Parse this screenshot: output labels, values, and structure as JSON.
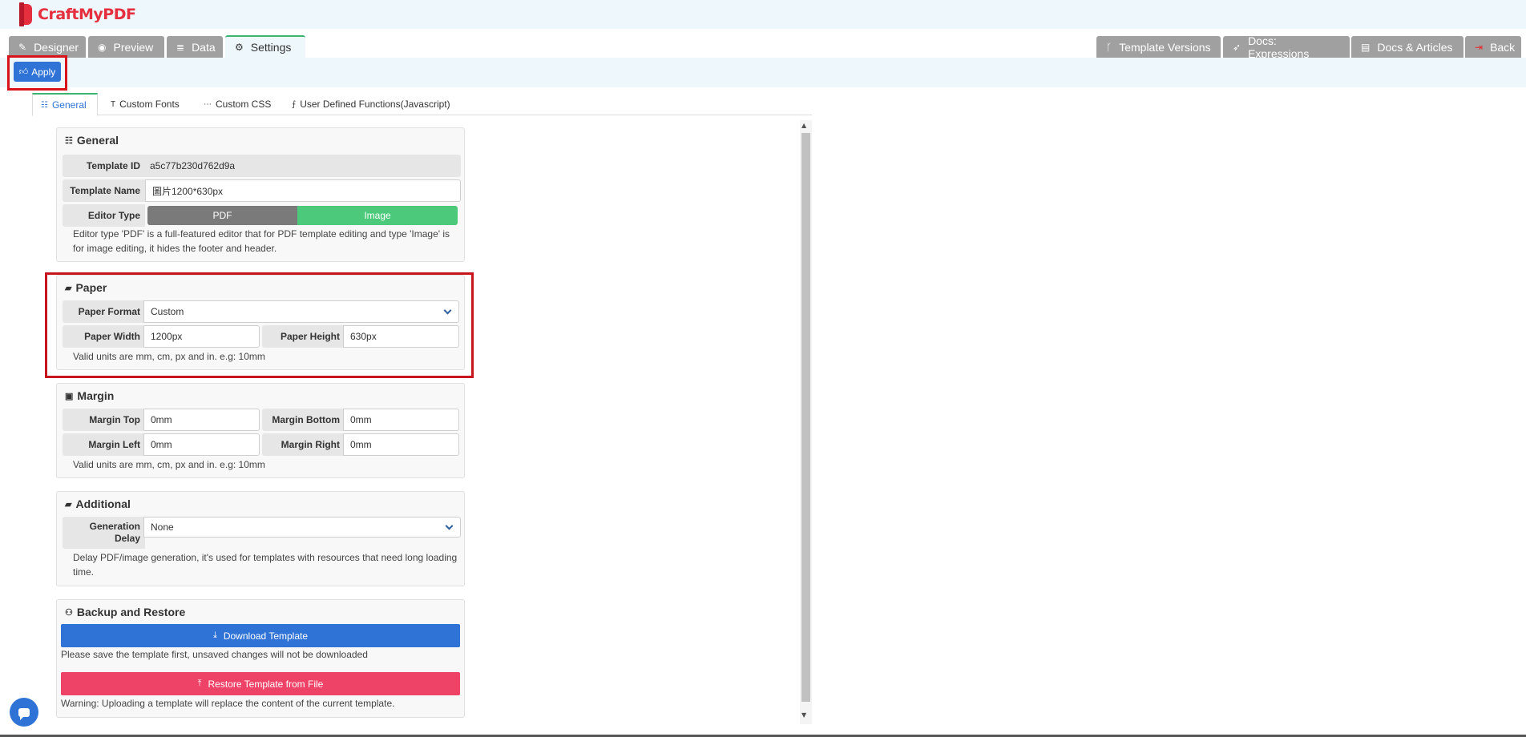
{
  "brand": {
    "logo_text": "CraftMyPDF",
    "accent": "#e52e3e"
  },
  "main_tabs": [
    {
      "label": "Designer",
      "icon": "pencil-icon"
    },
    {
      "label": "Preview",
      "icon": "eye-icon"
    },
    {
      "label": "Data",
      "icon": "database-icon"
    },
    {
      "label": "Settings",
      "icon": "gears-icon",
      "active": true
    }
  ],
  "right_tabs": [
    {
      "label": "Template Versions",
      "icon": "branch-icon"
    },
    {
      "label": "Docs: Expressions",
      "icon": "rocket-icon"
    },
    {
      "label": "Docs & Articles",
      "icon": "book-icon"
    },
    {
      "label": "Back",
      "icon": "exit-icon"
    }
  ],
  "apply": {
    "label": "Apply",
    "icon": "thumbs-up-icon"
  },
  "sub_tabs": [
    {
      "label": "General",
      "icon": "sliders-icon",
      "active": true
    },
    {
      "label": "Custom Fonts",
      "icon": "text-icon"
    },
    {
      "label": "Custom CSS",
      "icon": "code-icon"
    },
    {
      "label": "User Defined Functions(Javascript)",
      "icon": "function-icon"
    }
  ],
  "general": {
    "title": "General",
    "template_id_label": "Template ID",
    "template_id_value": "a5c77b230d762d9a",
    "template_name_label": "Template Name",
    "template_name_value": "圖片1200*630px",
    "editor_type_label": "Editor Type",
    "editor_pdf": "PDF",
    "editor_image": "Image",
    "help": "Editor type 'PDF' is a full-featured editor that for PDF template editing and type 'Image' is for image editing, it hides the footer and header."
  },
  "paper": {
    "title": "Paper",
    "format_label": "Paper Format",
    "format_value": "Custom",
    "width_label": "Paper Width",
    "width_value": "1200px",
    "height_label": "Paper Height",
    "height_value": "630px",
    "help": "Valid units are mm, cm, px and in. e.g: 10mm"
  },
  "margin": {
    "title": "Margin",
    "top_label": "Margin Top",
    "top_value": "0mm",
    "bottom_label": "Margin Bottom",
    "bottom_value": "0mm",
    "left_label": "Margin Left",
    "left_value": "0mm",
    "right_label": "Margin Right",
    "right_value": "0mm",
    "help": "Valid units are mm, cm, px and in. e.g: 10mm"
  },
  "additional": {
    "title": "Additional",
    "delay_label_line1": "Generation",
    "delay_label_line2": "Delay",
    "delay_value": "None",
    "help": "Delay PDF/image generation, it's used for templates with resources that need long loading time."
  },
  "backup": {
    "title": "Backup and Restore",
    "download_label": "Download Template",
    "download_note": "Please save the template first, unsaved changes will not be downloaded",
    "restore_label": "Restore Template from File",
    "restore_note": "Warning: Uploading a template will replace the content of the current template."
  },
  "colors": {
    "blue": "#2f73d6",
    "green": "#4cc97a",
    "red_button": "#ee4266",
    "gray_tab": "#a0a0a0",
    "highlight": "#d8141a"
  }
}
